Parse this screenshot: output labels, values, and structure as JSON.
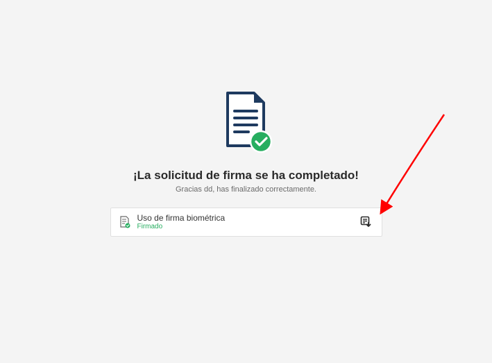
{
  "messages": {
    "title": "¡La solicitud de firma se ha completado!",
    "subtitle": "Gracias dd, has finalizado correctamente."
  },
  "document": {
    "name": "Uso de firma biométrica",
    "status": "Firmado"
  },
  "colors": {
    "success": "#27ae60",
    "darknavy": "#1e3a5f"
  }
}
